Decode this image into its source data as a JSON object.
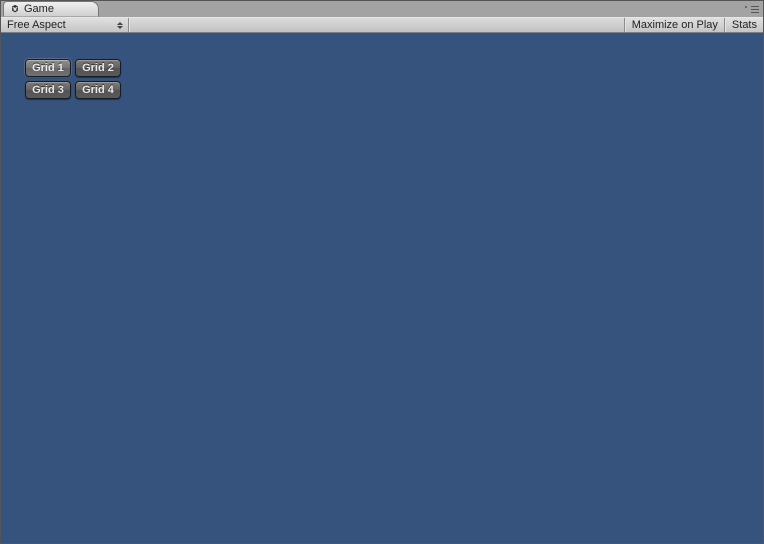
{
  "tabs": {
    "game": {
      "label": "Game"
    }
  },
  "toolbar": {
    "aspect_label": "Free Aspect",
    "maximize_label": "Maximize on Play",
    "stats_label": "Stats"
  },
  "viewport": {
    "bg": "#36537d",
    "buttons": [
      {
        "label": "Grid 1",
        "selected": true
      },
      {
        "label": "Grid 2",
        "selected": false
      },
      {
        "label": "Grid 3",
        "selected": false
      },
      {
        "label": "Grid 4",
        "selected": false
      }
    ]
  }
}
